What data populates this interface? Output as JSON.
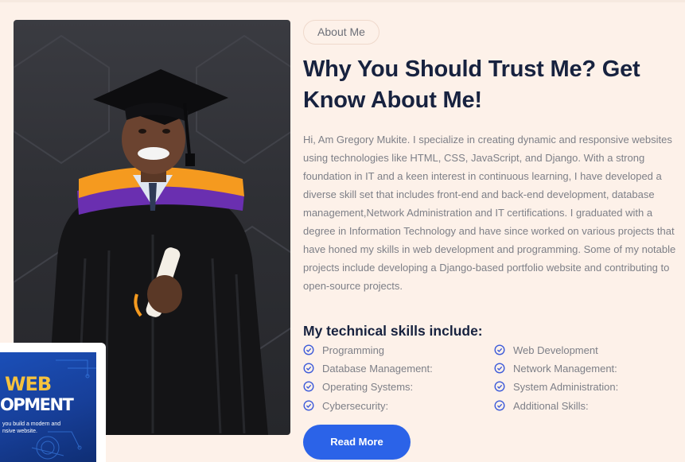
{
  "about": {
    "badge": "About Me",
    "headline": "Why You Should Trust Me? Get Know About Me!",
    "paragraph": "Hi, Am Gregory Mukite. I specialize in creating dynamic and responsive websites using technologies like HTML, CSS, JavaScript, and Django. With a strong foundation in IT and a keen interest in continuous learning, I have developed a diverse skill set that includes front-end and back-end development, database management,Network Administration and IT certifications. I graduated with a degree in Information Technology and have since worked on various projects that have honed my skills in web development and programming. Some of my notable projects include developing a Django-based portfolio website and contributing to open-source projects."
  },
  "skills": {
    "title": "My technical skills include:",
    "left": [
      "Programming",
      "Database Management:",
      "Operating Systems:",
      "Cybersecurity:"
    ],
    "right": [
      "Web Development",
      "Network Management:",
      "System Administration:",
      "Additional Skills:"
    ]
  },
  "cta": {
    "read_more": "Read More"
  },
  "mini_card": {
    "word1": "WEB",
    "word2": "OPMENT",
    "subtitle": "you build a modern and nsive website."
  },
  "colors": {
    "accent": "#2b63e8",
    "heading": "#17223f",
    "background": "#fdf1e9",
    "gown_trim": "#f59a1f",
    "gown_purple": "#6a2fb0"
  },
  "icons": {
    "skill_bullet": "check-circle-icon"
  }
}
